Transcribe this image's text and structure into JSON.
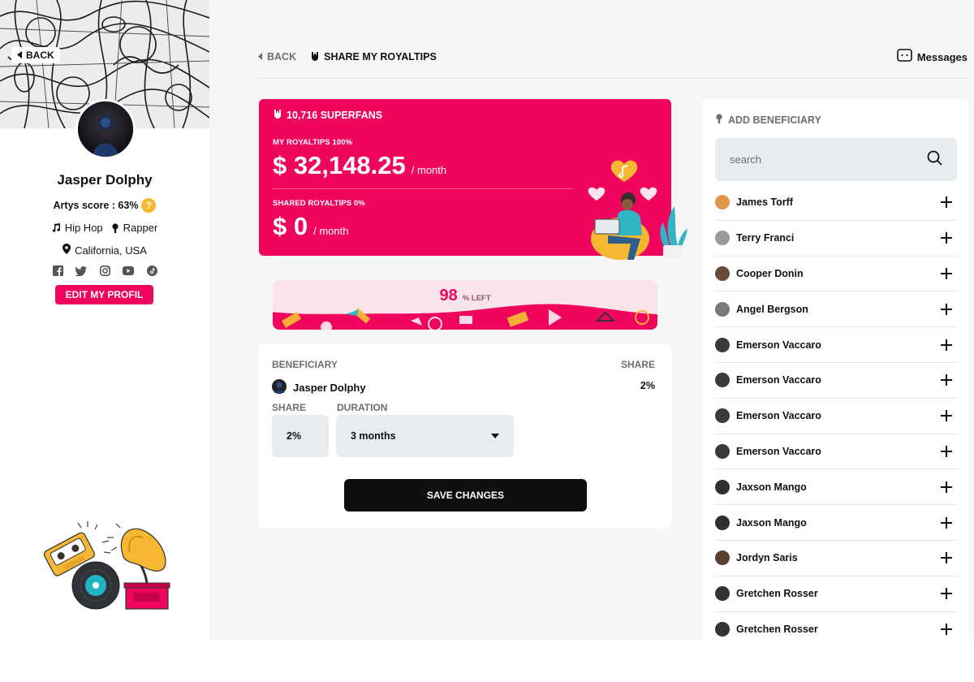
{
  "profile": {
    "back_label": "BACK",
    "name": "Jasper Dolphy",
    "score": "Artys score : 63%",
    "score_help": "?",
    "genre": "Hip Hop",
    "role": "Rapper",
    "location": "California, USA",
    "social_icons": [
      "facebook-icon",
      "twitter-icon",
      "instagram-icon",
      "youtube-icon",
      "tiktok-icon"
    ],
    "edit_label": "EDIT MY PROFIL"
  },
  "header": {
    "back_label": "BACK",
    "title": "SHARE MY ROYALTIPS",
    "messages_label": "Messages"
  },
  "stats": {
    "superfans": "10,716 SUPERFANS",
    "my_label": "MY ROYALTIPS 100%",
    "my_amount": "$ 32,148.25",
    "my_period": "/ month",
    "shared_label": "SHARED ROYALTIPS 0%",
    "shared_amount": "$ 0",
    "shared_period": "/ month"
  },
  "progress": {
    "percent_left": "98",
    "suffix": "% LEFT",
    "value": 98
  },
  "beneficiary": {
    "col_beneficiary": "BENEFICIARY",
    "col_share": "SHARE",
    "name": "Jasper  Dolphy",
    "share": "2%",
    "share_label": "SHARE",
    "duration_label": "DURATION",
    "share_value": "2%",
    "duration_value": "3 months",
    "save_label": "SAVE CHANGES"
  },
  "add_beneficiary": {
    "title": "ADD BENEFICIARY",
    "search_placeholder": "search",
    "people": [
      {
        "name": "James Torff",
        "avatar_color": "#e0954a"
      },
      {
        "name": "Terry Franci",
        "avatar_color": "#9a9a9a"
      },
      {
        "name": "Cooper Donin",
        "avatar_color": "#6b4a3a"
      },
      {
        "name": "Angel Bergson",
        "avatar_color": "#7a7a7a"
      },
      {
        "name": "Emerson Vaccaro",
        "avatar_color": "#3a3a3a"
      },
      {
        "name": "Emerson Vaccaro",
        "avatar_color": "#3a3a3a"
      },
      {
        "name": "Emerson Vaccaro",
        "avatar_color": "#3a3a3a"
      },
      {
        "name": "Emerson Vaccaro",
        "avatar_color": "#3a3a3a"
      },
      {
        "name": "Jaxson Mango",
        "avatar_color": "#2f2f2f"
      },
      {
        "name": "Jaxson Mango",
        "avatar_color": "#2f2f2f"
      },
      {
        "name": "Jordyn Saris",
        "avatar_color": "#5a4030"
      },
      {
        "name": "Gretchen Rosser",
        "avatar_color": "#333333"
      },
      {
        "name": "Gretchen Rosser",
        "avatar_color": "#333333"
      }
    ]
  },
  "colors": {
    "brand": "#f0055e",
    "dark_button": "#0f0f0f",
    "field_bg": "#e8ecee",
    "accent_yellow": "#f6b733"
  }
}
